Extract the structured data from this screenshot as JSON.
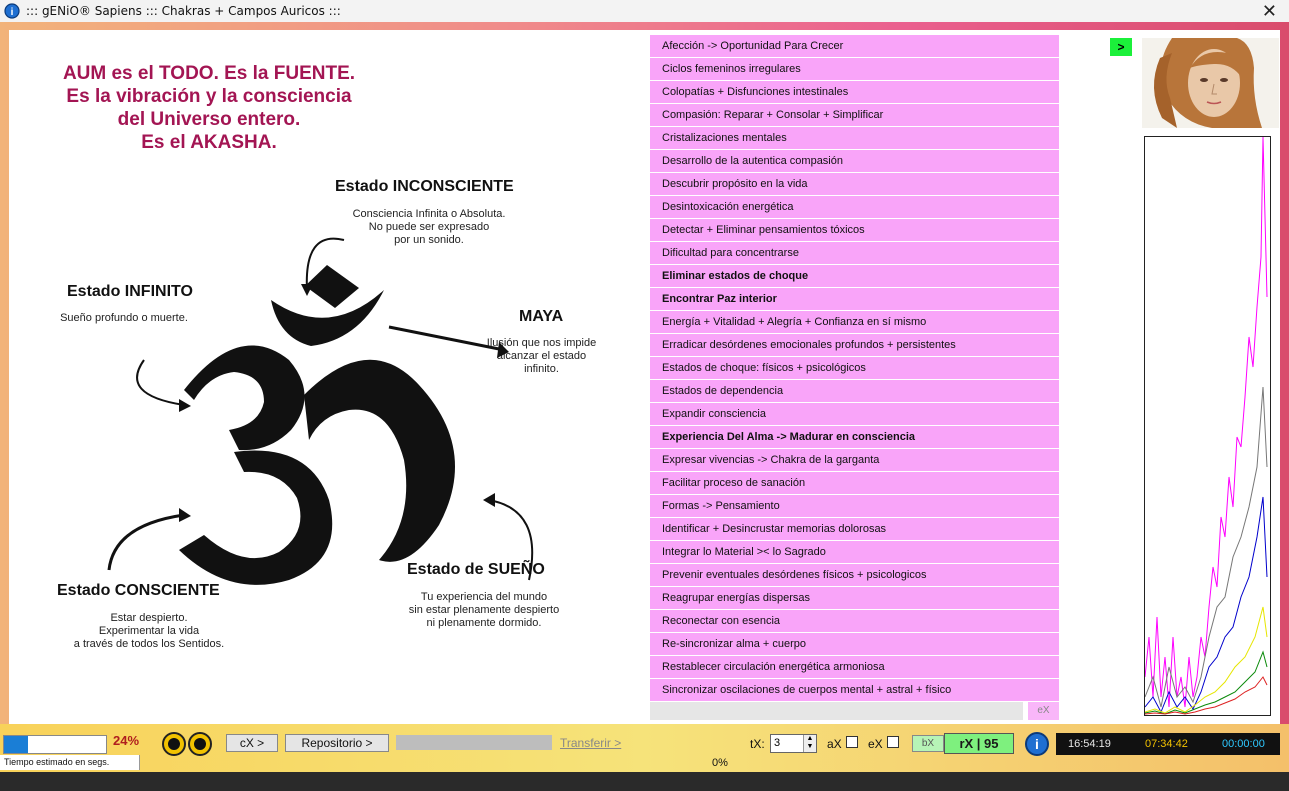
{
  "window": {
    "title": "::: gENiO® Sapiens ::: Chakras + Campos Auricos :::"
  },
  "aum_text": [
    "AUM es el TODO.  Es la FUENTE.",
    "Es la vibración y la consciencia",
    "del Universo entero.",
    "Es el AKASHA."
  ],
  "states": {
    "inconsciente": {
      "title": "Estado INCONSCIENTE",
      "desc": [
        "Consciencia Infinita o Absoluta.",
        "No puede ser expresado",
        "por un sonido."
      ]
    },
    "infinito": {
      "title": "Estado INFINITO",
      "desc": [
        "Sueño profundo o muerte."
      ]
    },
    "maya": {
      "title": "MAYA",
      "desc": [
        "Ilusión que nos impide",
        "alcanzar el estado",
        "infinito."
      ]
    },
    "consciente": {
      "title": "Estado CONSCIENTE",
      "desc": [
        "Estar despierto.",
        "Experimentar la vida",
        "a través de todos los Sentidos."
      ]
    },
    "sueno": {
      "title": "Estado de SUEÑO",
      "desc": [
        "Tu experiencia del mundo",
        "sin estar plenamente despierto",
        "ni plenamente dormido."
      ]
    }
  },
  "list_items": [
    {
      "label": "Afección -> Oportunidad Para Crecer",
      "bold": false
    },
    {
      "label": "Ciclos femeninos irregulares",
      "bold": false
    },
    {
      "label": "Colopatías + Disfunciones intestinales",
      "bold": false
    },
    {
      "label": "Compasión: Reparar + Consolar + Simplificar",
      "bold": false
    },
    {
      "label": "Cristalizaciones mentales",
      "bold": false
    },
    {
      "label": "Desarrollo de la autentica compasión",
      "bold": false
    },
    {
      "label": "Descubrir propósito en la vida",
      "bold": false
    },
    {
      "label": "Desintoxicación energética",
      "bold": false
    },
    {
      "label": "Detectar + Eliminar pensamientos tóxicos",
      "bold": false
    },
    {
      "label": "Dificultad para concentrarse",
      "bold": false
    },
    {
      "label": "Eliminar estados de choque",
      "bold": true
    },
    {
      "label": "Encontrar Paz interior",
      "bold": true
    },
    {
      "label": "Energía + Vitalidad + Alegría + Confianza en sí mismo",
      "bold": false
    },
    {
      "label": "Erradicar desórdenes emocionales profundos + persistentes",
      "bold": false
    },
    {
      "label": "Estados de choque: físicos + psicológicos",
      "bold": false
    },
    {
      "label": "Estados de dependencia",
      "bold": false
    },
    {
      "label": "Expandir consciencia",
      "bold": false
    },
    {
      "label": "Experiencia Del Alma -> Madurar en consciencia",
      "bold": true
    },
    {
      "label": "Expresar vivencias -> Chakra de la garganta",
      "bold": false
    },
    {
      "label": "Facilitar proceso de sanación",
      "bold": false
    },
    {
      "label": "Formas -> Pensamiento",
      "bold": false
    },
    {
      "label": "Identificar + Desincrustar memorias dolorosas",
      "bold": false
    },
    {
      "label": "Integrar lo Material >< lo Sagrado",
      "bold": false
    },
    {
      "label": "Prevenir eventuales desórdenes físicos + psicologicos",
      "bold": false
    },
    {
      "label": "Reagrupar energías dispersas",
      "bold": false
    },
    {
      "label": "Reconectar con esencia",
      "bold": false
    },
    {
      "label": "Re-sincronizar alma + cuerpo",
      "bold": false
    },
    {
      "label": "Restablecer circulación energética armoniosa",
      "bold": false
    },
    {
      "label": "Sincronizar oscilaciones de cuerpos mental + astral + físico",
      "bold": false
    }
  ],
  "ex_button": "eX",
  "go_button": ">",
  "toolbar": {
    "progress_percent": 24,
    "progress_label": "24%",
    "cx_button": "cX >",
    "repo_button": "Repositorio >",
    "transfer_link": "Transferir >",
    "tx_label": "tX:",
    "tx_value": "3",
    "ax_label": "aX",
    "ex_label": "eX",
    "bx_button": "bX",
    "rx_display": "rX | 95",
    "info_label": "i",
    "clock": {
      "time1": "16:54:19",
      "time2": "07:34:42",
      "time3": "00:00:00"
    }
  },
  "status": {
    "left_text": "Tiempo estimado en segs.",
    "pct": "0%"
  },
  "colors": {
    "list_bg": "#f9a4f9",
    "aum_text": "#a31553",
    "go_btn": "#1bf03a",
    "rx_bg": "#7ef07e"
  }
}
